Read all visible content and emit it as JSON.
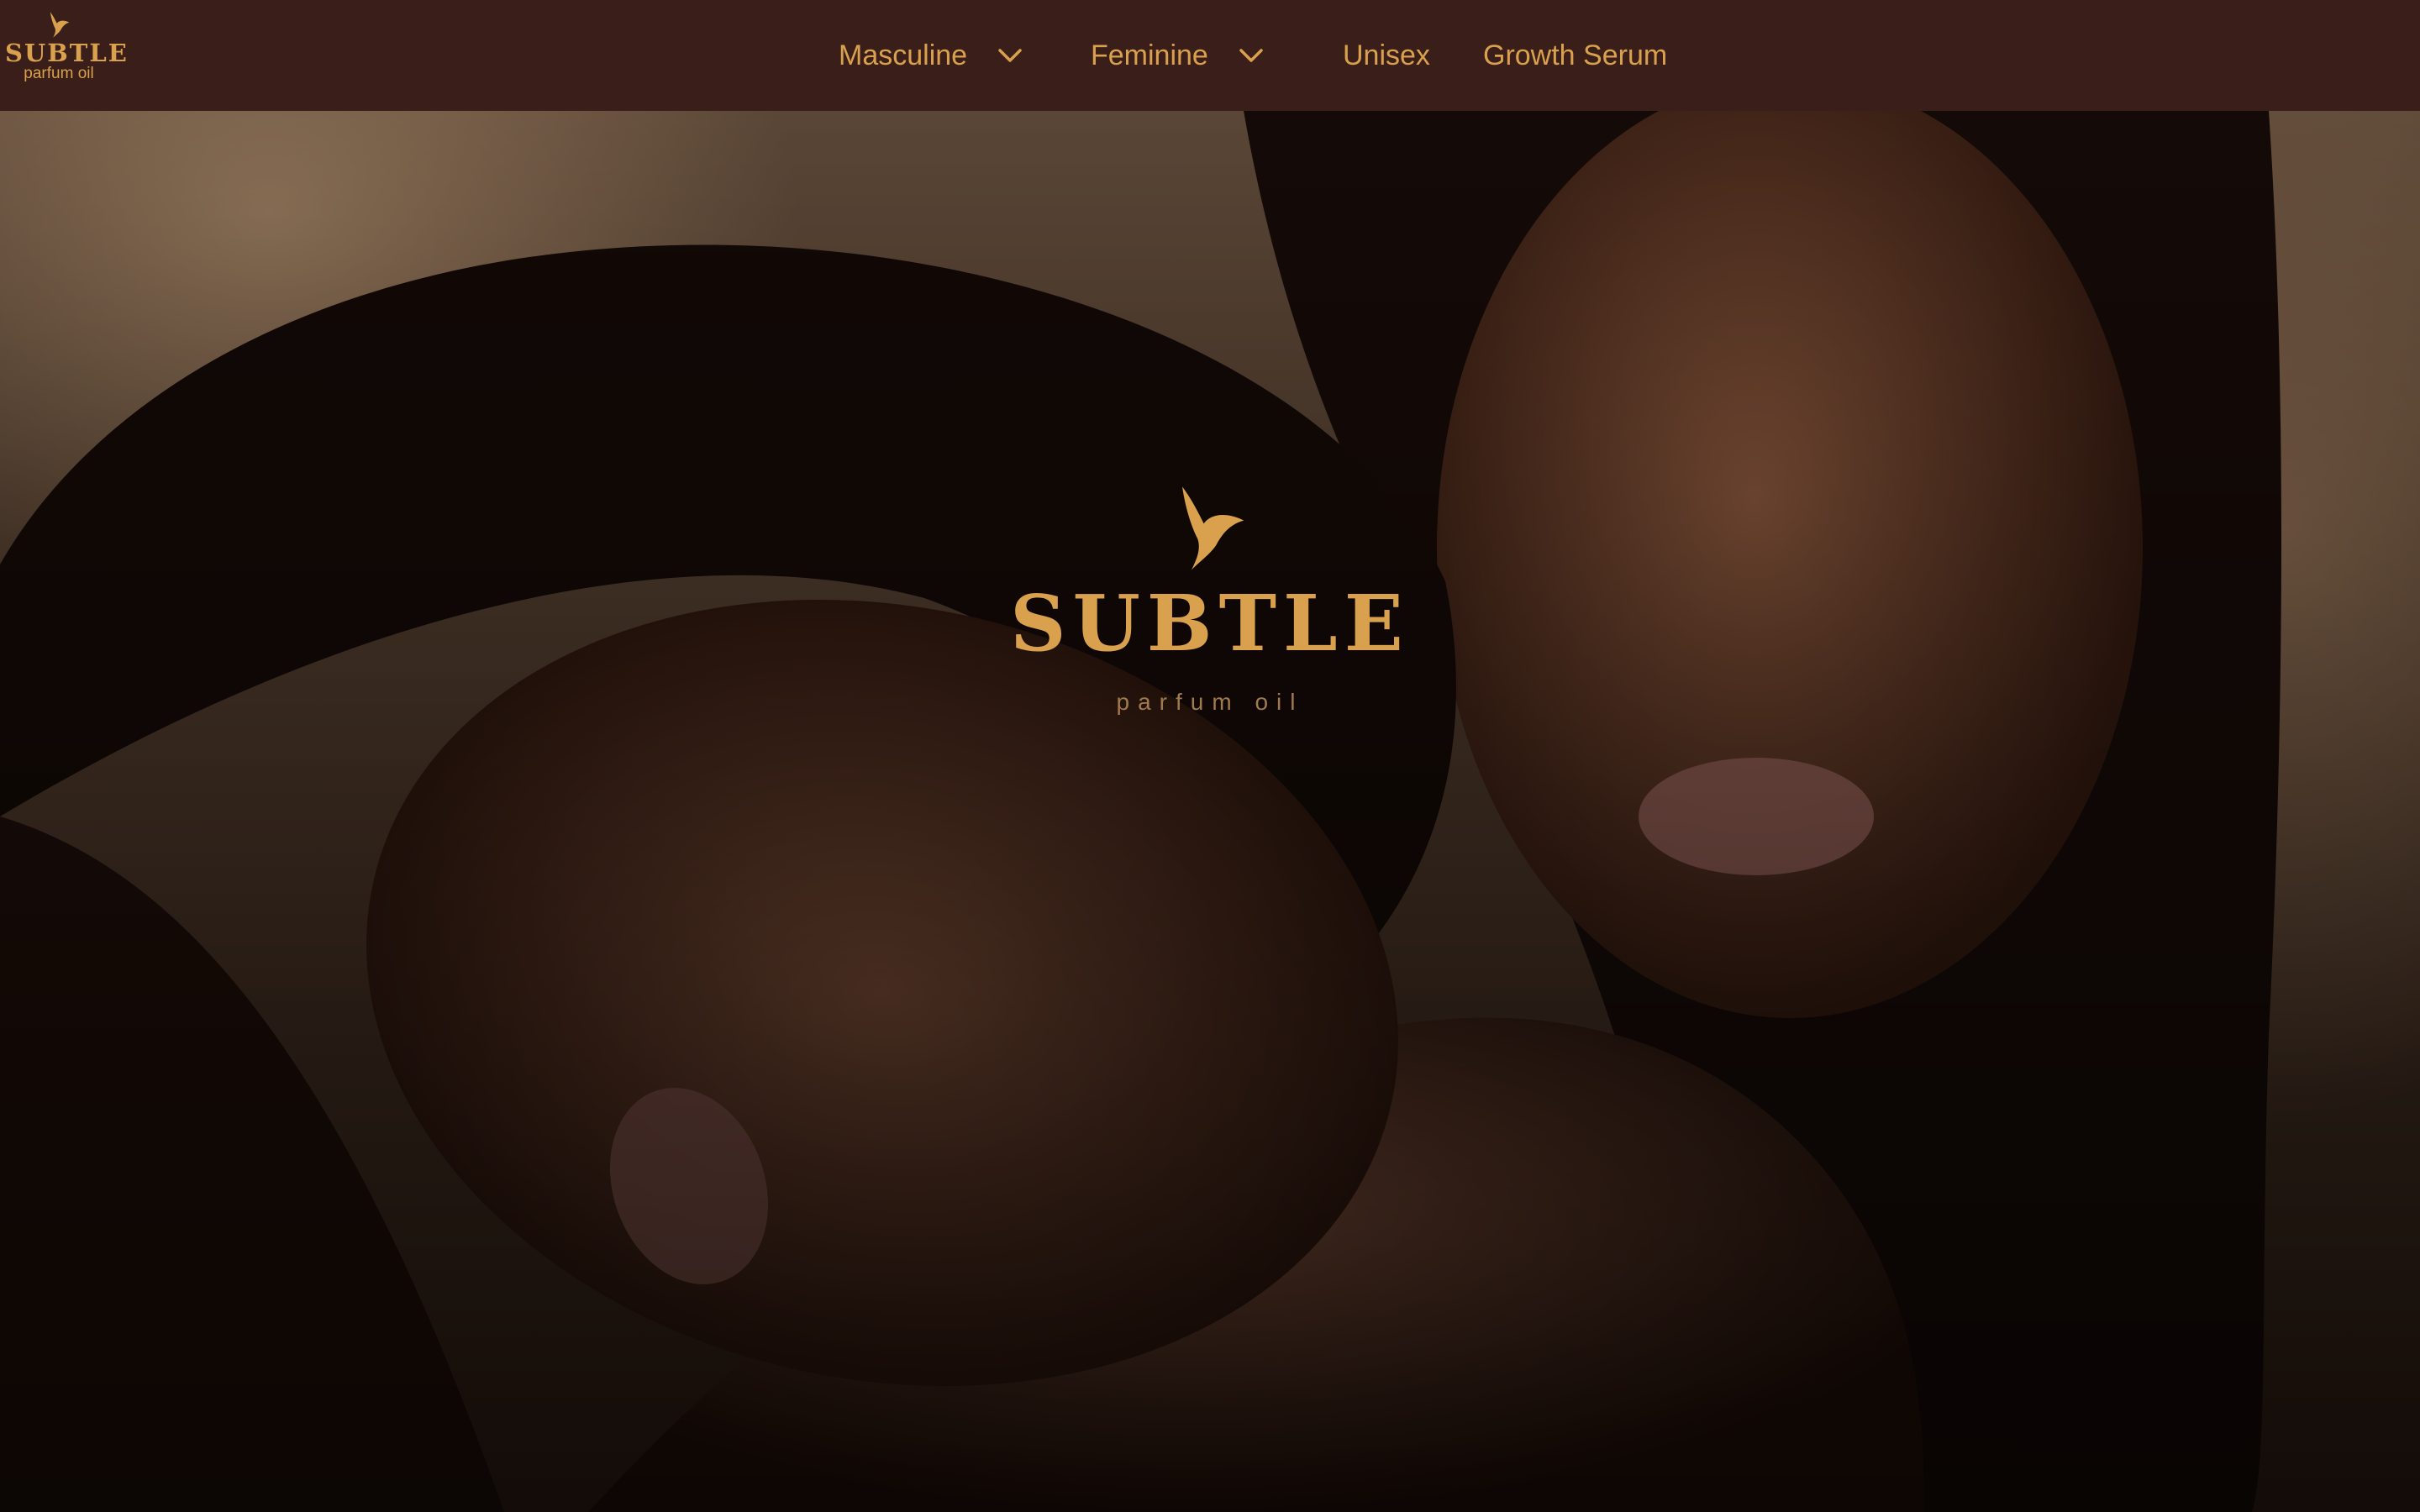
{
  "header": {
    "logo": {
      "brand": "SUBTLE",
      "sub": "parfum oil",
      "icon": "bird-logo-icon"
    },
    "nav": [
      {
        "label": "Masculine",
        "has_dropdown": true,
        "icon": "chevron-down-icon"
      },
      {
        "label": "Feminine",
        "has_dropdown": true,
        "icon": "chevron-down-icon"
      },
      {
        "label": "Unisex",
        "has_dropdown": false
      },
      {
        "label": "Growth Serum",
        "has_dropdown": false
      }
    ]
  },
  "hero": {
    "logo": {
      "brand": "SUBTLE",
      "sub": "parfum oil",
      "icon": "bird-logo-icon"
    },
    "image": "two-women-portrait-photo"
  },
  "colors": {
    "header_bg": "#3a1e19",
    "accent": "#d9a04e",
    "accent_muted": "#a07a4c"
  }
}
